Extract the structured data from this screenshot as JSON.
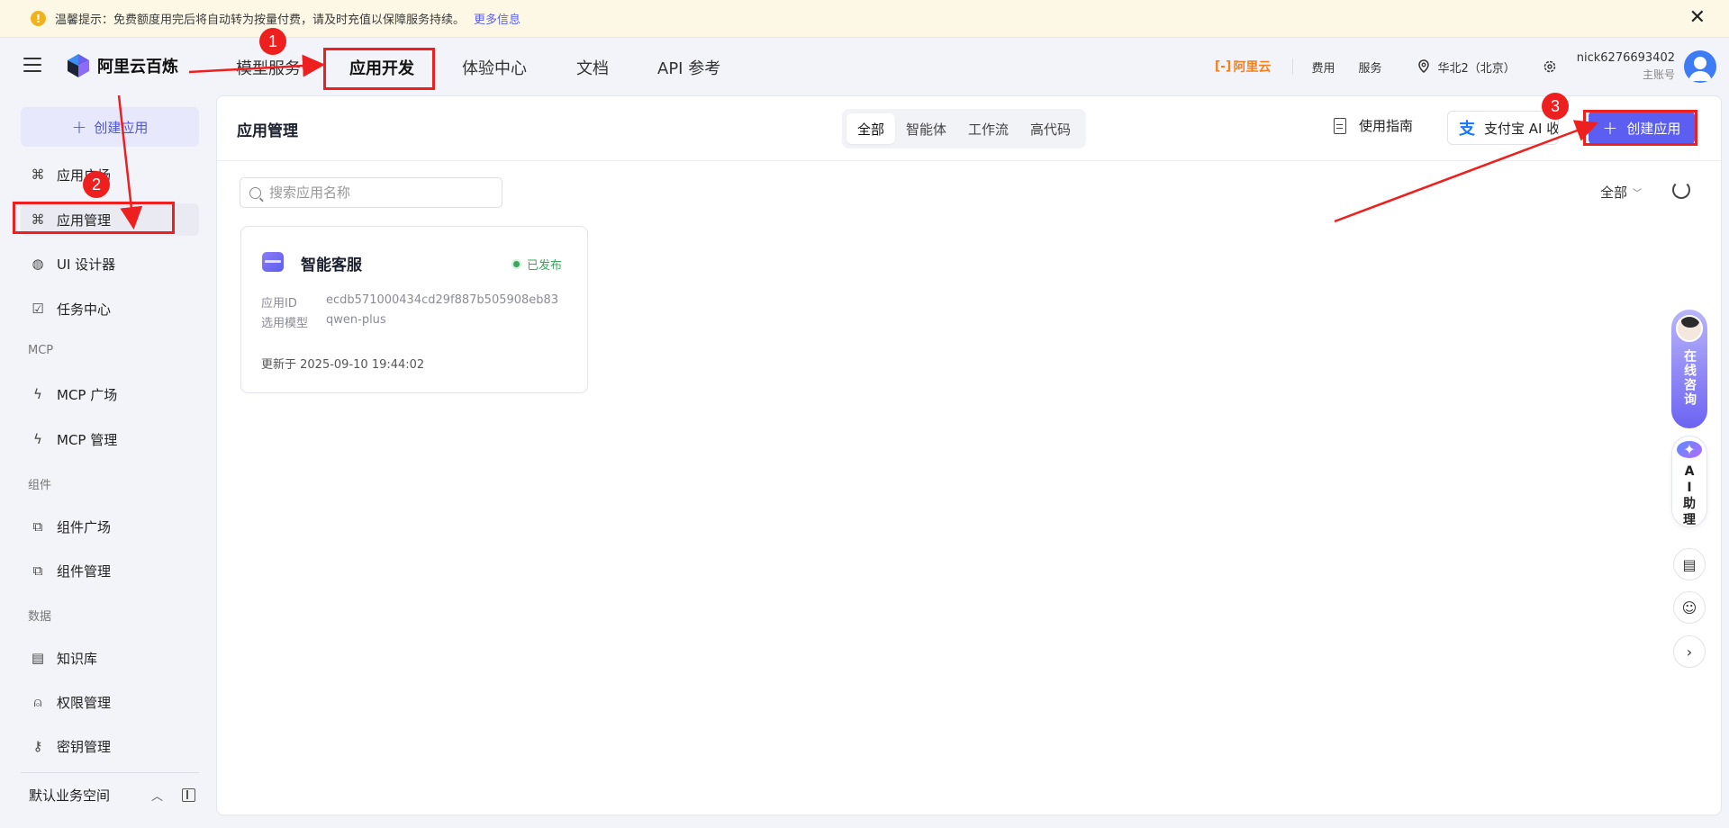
{
  "notice": {
    "icon": "warning-icon",
    "text": "温馨提示：免费额度用完后将自动转为按量付费，请及时充值以保障服务持续。",
    "link": "更多信息",
    "close_icon": "close-icon"
  },
  "topnav": {
    "brand": "阿里云百炼",
    "tabs": [
      {
        "label": "模型服务"
      },
      {
        "label": "应用开发"
      },
      {
        "label": "体验中心"
      },
      {
        "label": "文档"
      },
      {
        "label": "API 参考"
      }
    ],
    "active_tab": "应用开发",
    "aliyun": "阿里云",
    "billing": "费用",
    "service": "服务",
    "region": "华北2（北京）",
    "username": "nick6276693402",
    "account_type": "主账号"
  },
  "sidebar": {
    "create_label": "创建应用",
    "items": [
      {
        "label": "应用广场",
        "icon": "grid-icon"
      },
      {
        "label": "应用管理",
        "icon": "grid-icon"
      },
      {
        "label": "UI 设计器",
        "icon": "palette-icon"
      },
      {
        "label": "任务中心",
        "icon": "task-icon"
      }
    ],
    "section_mcp": "MCP",
    "mcp_items": [
      {
        "label": "MCP 广场",
        "icon": "lightning-icon"
      },
      {
        "label": "MCP 管理",
        "icon": "lightning-gear-icon"
      }
    ],
    "section_components": "组件",
    "component_items": [
      {
        "label": "组件广场",
        "icon": "puzzle-icon"
      },
      {
        "label": "组件管理",
        "icon": "puzzle-gear-icon"
      }
    ],
    "section_data": "数据",
    "data_items": [
      {
        "label": "知识库",
        "icon": "book-icon"
      },
      {
        "label": "权限管理",
        "icon": "user-icon"
      },
      {
        "label": "密钥管理",
        "icon": "key-icon"
      }
    ],
    "workspace": "默认业务空间"
  },
  "main": {
    "title": "应用管理",
    "segments": [
      "全部",
      "智能体",
      "工作流",
      "高代码"
    ],
    "active_segment": "全部",
    "guide_label": "使用指南",
    "alipay_label": "支付宝 AI 收",
    "create_label": "创建应用",
    "search_placeholder": "搜索应用名称",
    "filter_label": "全部",
    "cards": [
      {
        "title": "智能客服",
        "status": "已发布",
        "id_label": "应用ID",
        "id_value": "ecdb571000434cd29f887b505908eb83",
        "model_label": "选用模型",
        "model_value": "qwen-plus",
        "updated": "更新于 2025-09-10 19:44:02"
      }
    ]
  },
  "floating": {
    "consult": "在线咨询",
    "assistant": "AI助理"
  },
  "annotations": {
    "badges": [
      "1",
      "2",
      "3"
    ]
  },
  "colors": {
    "accent": "#5b5ef0",
    "annotation": "#ee1f1f",
    "published": "#3da55d",
    "aliyun": "#f5801e"
  }
}
